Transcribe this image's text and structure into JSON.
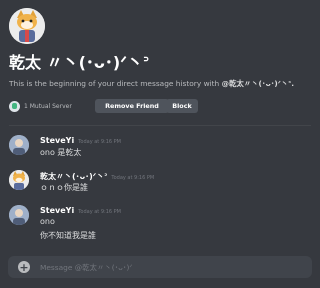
{
  "profile": {
    "name": "乾太 〃丶(･ᴗ･)ᐟ丶ᐣ",
    "intro_prefix": "This is the beginning of your direct message history with ",
    "intro_handle": "@乾太〃丶(･ᴗ･)ᐟ丶ᐣ.",
    "mutual_server": "1 Mutual Server",
    "remove_friend_label": "Remove Friend",
    "block_label": "Block"
  },
  "messages": [
    {
      "author": "SteveYi",
      "time": "Today at 9:16 PM",
      "lines": [
        "ono 是乾太"
      ]
    },
    {
      "author": "乾太〃丶(･ᴗ･)ᐟ丶ᐣ",
      "time": "Today at 9:16 PM",
      "lines": [
        "ｏｎｏ你是誰"
      ]
    },
    {
      "author": "SteveYi",
      "time": "Today at 9:16 PM",
      "lines": [
        "ono",
        "你不知道我是誰"
      ]
    }
  ],
  "composer": {
    "placeholder": "Message @乾太〃丶(･ᴗ･)ᐟ"
  },
  "colors": {
    "background": "#36393f",
    "button": "#4f545c",
    "composer": "#40444b"
  }
}
